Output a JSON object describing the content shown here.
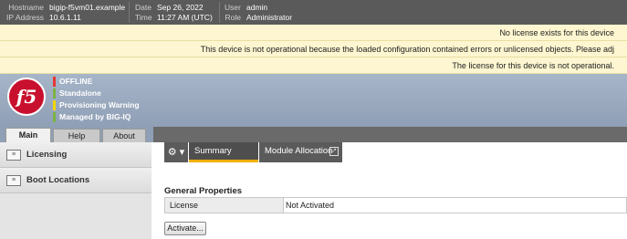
{
  "topbar": {
    "hostname_label": "Hostname",
    "hostname": "bigip-f5vm01.example",
    "ip_label": "IP Address",
    "ip": "10.6.1.11",
    "date_label": "Date",
    "date": "Sep 26, 2022",
    "time_label": "Time",
    "time": "11:27 AM (UTC)",
    "user_label": "User",
    "user": "admin",
    "role_label": "Role",
    "role": "Administrator"
  },
  "notices": [
    "No license exists for this device",
    "This device is not operational because the loaded configuration contained errors or unlicensed objects. Please adj",
    "The license for this device is not operational."
  ],
  "header": {
    "logo_text": "f5",
    "statuses": [
      {
        "label": "OFFLINE",
        "color": "#e53935"
      },
      {
        "label": "Standalone",
        "color": "#7cb342"
      },
      {
        "label": "Provisioning Warning",
        "color": "#f2d600"
      },
      {
        "label": "Managed by BIG-IQ",
        "color": "#7cb342"
      }
    ]
  },
  "tabs": [
    "Main",
    "Help",
    "About"
  ],
  "sidebar": {
    "items": [
      {
        "label": "Licensing",
        "icon": "license-icon"
      },
      {
        "label": "Boot Locations",
        "icon": "boot-icon"
      }
    ]
  },
  "toolbar": {
    "gear_icon": "⚙ ▾",
    "tabs": [
      "Summary",
      "Module Allocation"
    ],
    "ext_icon": "↗"
  },
  "content": {
    "section_title": "General Properties",
    "license_label": "License",
    "license_value": "Not Activated",
    "activate_button": "Activate..."
  },
  "colors": {
    "accent": "#f2b000",
    "brand": "#c8102e"
  }
}
